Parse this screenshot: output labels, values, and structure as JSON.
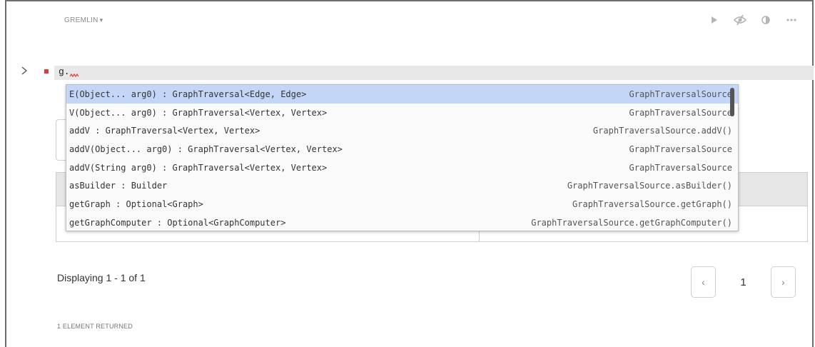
{
  "paragraph": {
    "language_label": "GREMLIN",
    "editor_text": "g.",
    "toolbar": [
      "run-icon",
      "hide-code-icon",
      "toggle-output-icon",
      "more-icon"
    ]
  },
  "autocomplete": {
    "items": [
      {
        "label": "E(Object... arg0) : GraphTraversal<Edge, Edge>",
        "meta": "GraphTraversalSource",
        "selected": true
      },
      {
        "label": "V(Object... arg0) : GraphTraversal<Vertex, Vertex>",
        "meta": "GraphTraversalSource"
      },
      {
        "label": "addV : GraphTraversal<Vertex, Vertex>",
        "meta": "GraphTraversalSource.addV()"
      },
      {
        "label": "addV(Object... arg0) : GraphTraversal<Vertex, Vertex>",
        "meta": "GraphTraversalSource"
      },
      {
        "label": "addV(String arg0) : GraphTraversal<Vertex, Vertex>",
        "meta": "GraphTraversalSource"
      },
      {
        "label": "asBuilder : Builder",
        "meta": "GraphTraversalSource.asBuilder()"
      },
      {
        "label": "getGraph : Optional<Graph>",
        "meta": "GraphTraversalSource.getGraph()"
      },
      {
        "label": "getGraphComputer : Optional<GraphComputer>",
        "meta": "GraphTraversalSource.getGraphComputer()"
      }
    ]
  },
  "results": {
    "display_count": "Displaying 1 - 1 of 1",
    "footer_note": "1 ELEMENT RETURNED",
    "pager": {
      "current_page": "1",
      "prev": "‹",
      "next": "›"
    }
  }
}
